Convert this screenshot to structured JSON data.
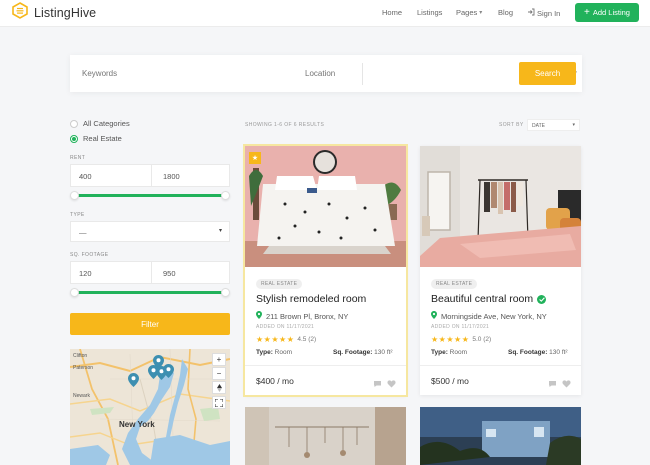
{
  "header": {
    "logo_text": "ListingHive",
    "nav": {
      "home": "Home",
      "listings": "Listings",
      "pages": "Pages",
      "blog": "Blog",
      "signin": "Sign In"
    },
    "add_listing": "Add Listing"
  },
  "search": {
    "keywords_placeholder": "Keywords",
    "location_placeholder": "Location",
    "button": "Search"
  },
  "sidebar": {
    "categories": [
      {
        "label": "All Categories",
        "selected": false
      },
      {
        "label": "Real Estate",
        "selected": true
      }
    ],
    "rent": {
      "label": "RENT",
      "min": "400",
      "max": "1800"
    },
    "type": {
      "label": "TYPE",
      "value": "—"
    },
    "sq_footage": {
      "label": "SQ. FOOTAGE",
      "min": "120",
      "max": "950"
    },
    "filter_button": "Filter",
    "map": {
      "labels": {
        "clifton": "Clifton",
        "paterson": "Paterson",
        "newark": "Newark",
        "new_york": "New York"
      },
      "zoom_in": "+",
      "zoom_out": "−"
    }
  },
  "results": {
    "showing": "SHOWING 1-6 OF 6 RESULTS",
    "sort_by_label": "SORT BY",
    "sort_value": "DATE"
  },
  "listings": [
    {
      "category": "REAL ESTATE",
      "title": "Stylish remodeled room",
      "verified": false,
      "featured": true,
      "address": "211 Brown Pl, Bronx, NY",
      "added": "ADDED ON 11/17/2021",
      "stars": "★★★★★",
      "rating": "4.5 (2)",
      "type_label": "Type:",
      "type_value": "Room",
      "sq_label": "Sq. Footage:",
      "sq_value": "130 ft²",
      "price": "$400 / mo"
    },
    {
      "category": "REAL ESTATE",
      "title": "Beautiful central room",
      "verified": true,
      "featured": false,
      "address": "Morningside Ave, New York, NY",
      "added": "ADDED ON 11/17/2021",
      "stars": "★★★★★",
      "rating": "5.0 (2)",
      "type_label": "Type:",
      "type_value": "Room",
      "sq_label": "Sq. Footage:",
      "sq_value": "130 ft²",
      "price": "$500 / mo"
    }
  ],
  "colors": {
    "accent_yellow": "#f7b71a",
    "accent_green": "#21b25b",
    "map_pin": "#3d8fb1"
  },
  "icons": [
    "hive-logo-icon",
    "chevron-down-icon",
    "sign-in-icon",
    "plus-icon",
    "location-arrow-icon",
    "map-pin-icon",
    "star-icon",
    "verified-check-icon",
    "chat-icon",
    "heart-icon",
    "fullscreen-icon",
    "compass-icon"
  ]
}
